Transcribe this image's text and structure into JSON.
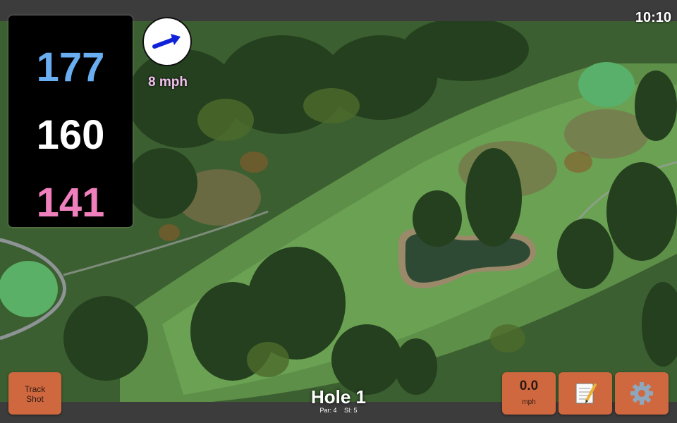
{
  "status_bar": {
    "time": "10:10"
  },
  "distances": {
    "back": "177",
    "middle": "160",
    "front": "141",
    "colors": {
      "back": "#6aaef2",
      "middle": "#ffffff",
      "front": "#ef7fbd"
    }
  },
  "wind": {
    "speed_label": "8 mph",
    "direction_icon": "arrow-icon"
  },
  "hole": {
    "title": "Hole 1",
    "par": "Par: 4",
    "stroke_index": "SI: 5"
  },
  "buttons": {
    "track_shot_line1": "Track",
    "track_shot_line2": "Shot",
    "speed_value": "0.0",
    "speed_unit": "mph",
    "notes_icon": "notepad-icon",
    "settings_icon": "gear-icon"
  },
  "accent_color": "#d0683f"
}
